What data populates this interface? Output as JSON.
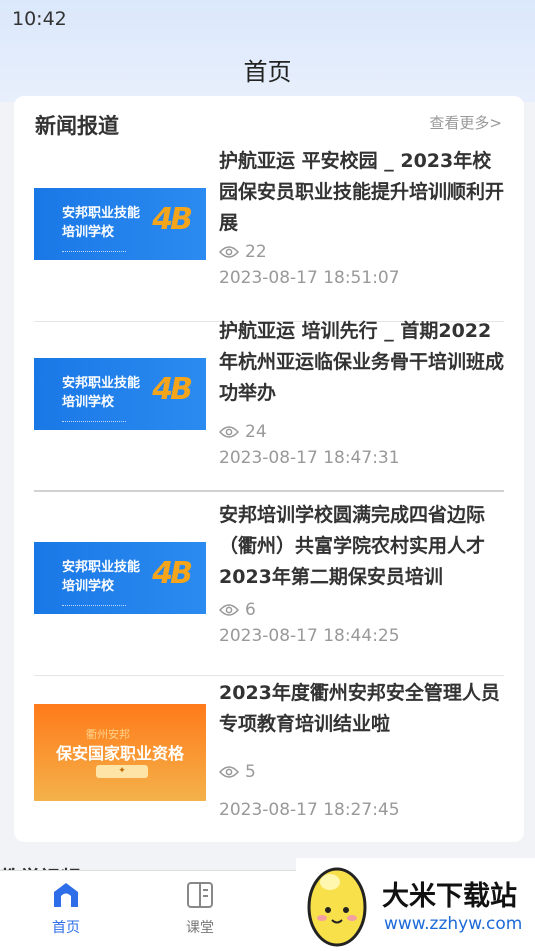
{
  "status": {
    "time": "10:42"
  },
  "header": {
    "title": "首页"
  },
  "news": {
    "section_title": "新闻报道",
    "see_more": "查看更多>",
    "items": [
      {
        "title": "护航亚运 平安校园 _ 2023年校园保安员职业技能提升培训顺利开展",
        "views": "22",
        "date": "2023-08-17 18:51:07",
        "thumb": {
          "line1": "安邦职业技能",
          "line2": "培训学校"
        }
      },
      {
        "title": "护航亚运 培训先行 _ 首期2022年杭州亚运临保业务骨干培训班成功举办",
        "views": "24",
        "date": "2023-08-17 18:47:31",
        "thumb": {
          "line1": "安邦职业技能",
          "line2": "培训学校"
        }
      },
      {
        "title": "安邦培训学校圆满完成四省边际（衢州）共富学院农村实用人才2023年第二期保安员培训",
        "views": "6",
        "date": "2023-08-17 18:44:25",
        "thumb": {
          "line1": "安邦职业技能",
          "line2": "培训学校"
        }
      },
      {
        "title": "2023年度衢州安邦安全管理人员专项教育培训结业啦",
        "views": "5",
        "date": "2023-08-17 18:27:45",
        "thumb": {
          "top": "衢州安邦",
          "main": "保安国家职业资格"
        }
      }
    ]
  },
  "next_section": {
    "title": "教学视频"
  },
  "tabbar": {
    "home": "首页",
    "class": "课堂"
  },
  "watermark": {
    "title": "大米下载站",
    "url": "www.zzhyw.com"
  },
  "colors": {
    "accent": "#2e6ee8",
    "header_bg": "#dbe8fb",
    "muted": "#999999"
  }
}
